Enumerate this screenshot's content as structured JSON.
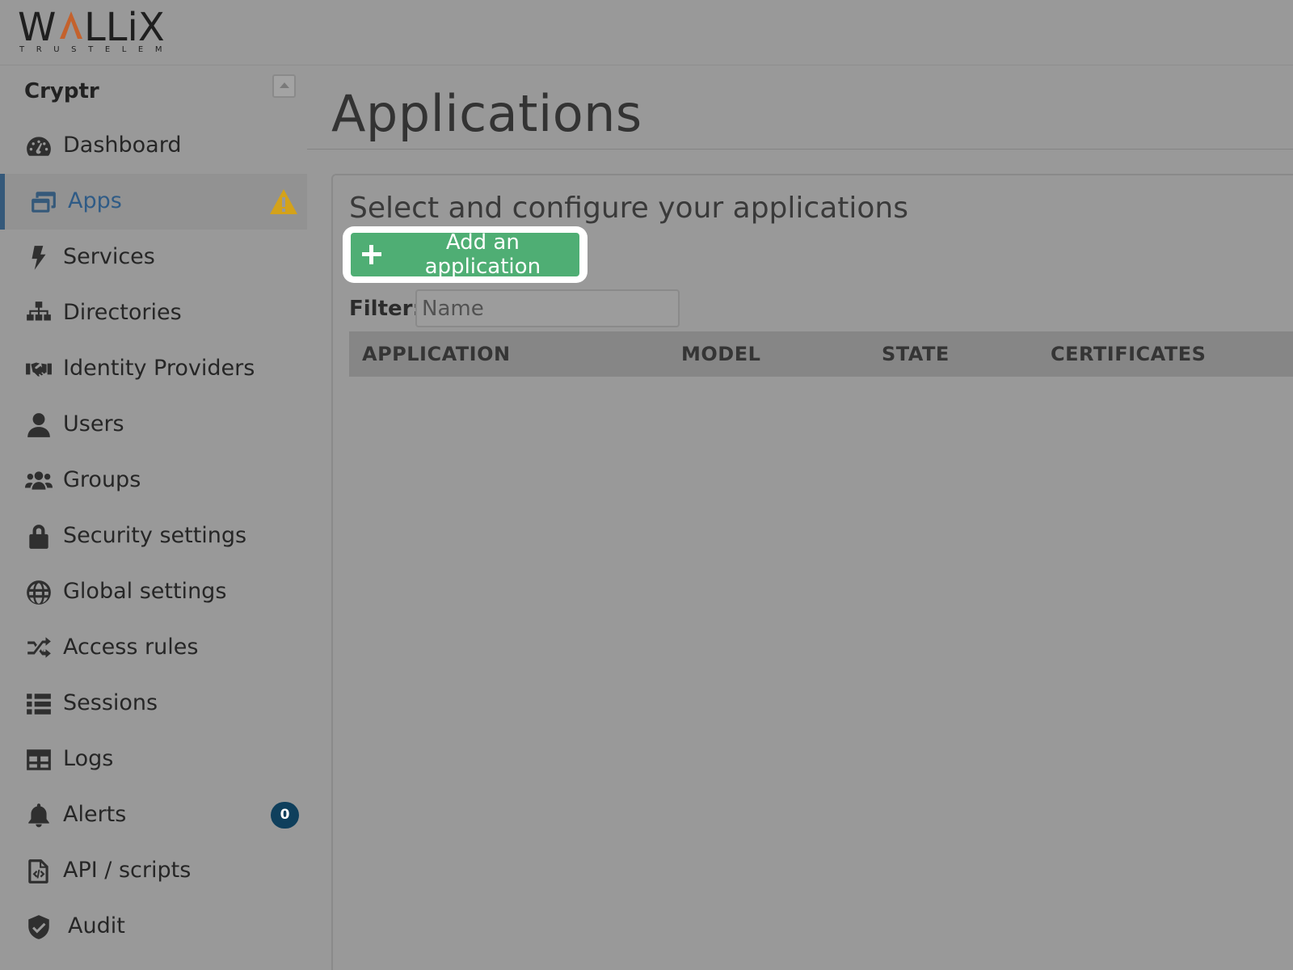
{
  "brand": {
    "logo_text": "WALLIX",
    "logo_sub": "TRUSTELEM",
    "accent": "#c4622d"
  },
  "sidebar": {
    "org_name": "Cryptr",
    "items": [
      {
        "label": "Dashboard",
        "icon": "dashboard-icon"
      },
      {
        "label": "Apps",
        "icon": "apps-icon",
        "active": true,
        "warning": true
      },
      {
        "label": "Services",
        "icon": "bolt-icon"
      },
      {
        "label": "Directories",
        "icon": "sitemap-icon"
      },
      {
        "label": "Identity Providers",
        "icon": "handshake-icon"
      },
      {
        "label": "Users",
        "icon": "user-icon"
      },
      {
        "label": "Groups",
        "icon": "users-icon"
      },
      {
        "label": "Security settings",
        "icon": "lock-icon"
      },
      {
        "label": "Global settings",
        "icon": "globe-icon"
      },
      {
        "label": "Access rules",
        "icon": "shuffle-icon"
      },
      {
        "label": "Sessions",
        "icon": "list-icon"
      },
      {
        "label": "Logs",
        "icon": "table-icon"
      },
      {
        "label": "Alerts",
        "icon": "bell-icon",
        "badge": "0"
      },
      {
        "label": "API / scripts",
        "icon": "file-code-icon"
      },
      {
        "label": "Audit",
        "icon": "shield-check-icon"
      }
    ]
  },
  "main": {
    "title": "Applications",
    "heading": "Select and configure your applications",
    "add_button": "Add an application",
    "filter_label": "Filter:",
    "filter_placeholder": "Name",
    "columns": [
      "APPLICATION",
      "MODEL",
      "STATE",
      "CERTIFICATES"
    ]
  },
  "colors": {
    "active_nav": "#2f5b86",
    "add_button_bg": "#4fae74",
    "warning": "#d4a21a",
    "badge_bg": "#0f3f5c"
  }
}
